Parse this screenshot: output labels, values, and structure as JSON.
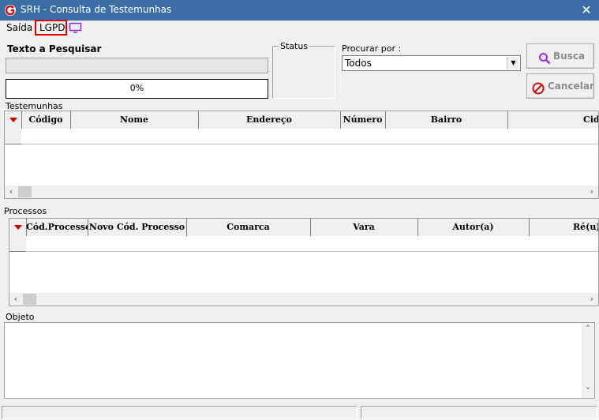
{
  "window": {
    "title": "SRH - Consulta de Testemunhas",
    "close_glyph": "✕"
  },
  "menu": {
    "saida": "Saída",
    "lgpd": "LGPD"
  },
  "search": {
    "label": "Texto a Pesquisar",
    "value": "",
    "progress": "0%",
    "progress_value": 0
  },
  "status_group": {
    "label": "Status"
  },
  "procurar": {
    "label": "Procurar por :",
    "selected": "Todos"
  },
  "buttons": {
    "busca": "Busca",
    "cancelar": "Cancelar"
  },
  "testemunhas": {
    "label": "Testemunhas",
    "columns": [
      "Código",
      "Nome",
      "Endereço",
      "Número",
      "Bairro",
      "Cidade"
    ]
  },
  "processos": {
    "label": "Processos",
    "columns": [
      "Cód.Processo",
      "Novo Cód. Processo",
      "Comarca",
      "Vara",
      "Autor(a)",
      "Ré(u)"
    ]
  },
  "objeto": {
    "label": "Objeto",
    "value": ""
  },
  "colors": {
    "titlebar": "#3a6ea5",
    "lgpd_border": "#e00000",
    "icon_purple": "#8a2be2",
    "indicator_red": "#d00000"
  },
  "icons": {
    "app": "app-logo-icon",
    "monitor": "monitor-icon",
    "search": "magnifier-icon",
    "cancel": "cancel-icon"
  }
}
